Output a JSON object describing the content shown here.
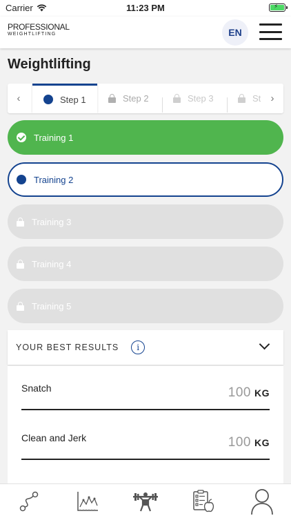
{
  "status_bar": {
    "carrier": "Carrier",
    "time": "11:23 PM"
  },
  "header": {
    "logo_top": "PROFESSIONAL",
    "logo_bottom": "WEIGHTLIFTING",
    "language": "EN"
  },
  "page_title": "Weightlifting",
  "steps": [
    {
      "label": "Step 1",
      "state": "active"
    },
    {
      "label": "Step 2",
      "state": "locked"
    },
    {
      "label": "Step 3",
      "state": "locked"
    },
    {
      "label": "St",
      "state": "locked"
    }
  ],
  "trainings": [
    {
      "label": "Training 1",
      "state": "done"
    },
    {
      "label": "Training 2",
      "state": "current"
    },
    {
      "label": "Training 3",
      "state": "locked"
    },
    {
      "label": "Training 4",
      "state": "locked"
    },
    {
      "label": "Training 5",
      "state": "locked"
    }
  ],
  "results": {
    "title": "YOUR BEST RESULTS",
    "info_glyph": "i",
    "rows": [
      {
        "label": "Snatch",
        "value": "100",
        "unit": "KG"
      },
      {
        "label": "Clean and Jerk",
        "value": "100",
        "unit": "KG"
      }
    ]
  },
  "tabs": [
    {
      "icon": "route-icon"
    },
    {
      "icon": "stats-chart-icon"
    },
    {
      "icon": "weightlifter-icon"
    },
    {
      "icon": "nutrition-checklist-icon"
    },
    {
      "icon": "profile-icon"
    }
  ],
  "colors": {
    "accent": "#14438f",
    "done_green": "#50b54e",
    "locked_gray": "#e0e0e0"
  }
}
